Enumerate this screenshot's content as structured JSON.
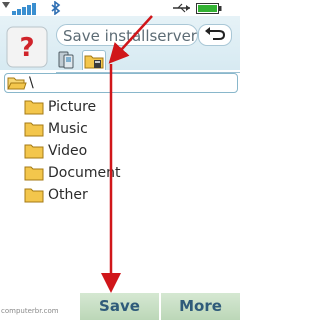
{
  "header": {
    "title": "Save installserver",
    "help_icon": "question-icon",
    "back_icon": "back-arrow-icon",
    "tabs": [
      {
        "icon": "phone-memory-icon",
        "selected": false
      },
      {
        "icon": "memory-card-folder-icon",
        "selected": true
      }
    ]
  },
  "path": {
    "label": "\\"
  },
  "folders": [
    {
      "label": "Picture"
    },
    {
      "label": "Music"
    },
    {
      "label": "Video"
    },
    {
      "label": "Document"
    },
    {
      "label": "Other"
    }
  ],
  "softkeys": {
    "left": "Save",
    "right": "More"
  },
  "watermark": "computerbr.com",
  "colors": {
    "accent": "#2f5b7a",
    "annotation_arrow": "#d0161a",
    "softkey_bg": "#c8dfc4"
  }
}
